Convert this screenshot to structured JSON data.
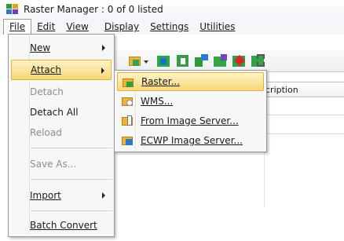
{
  "window": {
    "title": "Raster Manager : 0 of 0 listed"
  },
  "menubar": {
    "items": [
      {
        "label": "File"
      },
      {
        "label": "Edit"
      },
      {
        "label": "View"
      },
      {
        "label": "Display"
      },
      {
        "label": "Settings"
      },
      {
        "label": "Utilities"
      }
    ]
  },
  "grid": {
    "description_header": "cription"
  },
  "file_menu": {
    "items": [
      {
        "label": "New",
        "enabled": true,
        "submenu": true
      },
      {
        "label": "Attach",
        "enabled": true,
        "submenu": true,
        "highlighted": true
      },
      {
        "label": "Detach",
        "enabled": false
      },
      {
        "label": "Detach All",
        "enabled": true
      },
      {
        "label": "Reload",
        "enabled": false
      },
      {
        "label": "Save As...",
        "enabled": false
      },
      {
        "label": "Import",
        "enabled": true,
        "submenu": true
      },
      {
        "label": "Batch Convert",
        "enabled": true
      }
    ]
  },
  "attach_menu": {
    "items": [
      {
        "label": "Raster...",
        "highlighted": true
      },
      {
        "label": "WMS..."
      },
      {
        "label": "From Image Server..."
      },
      {
        "label": "ECWP Image Server..."
      }
    ]
  },
  "colors": {
    "highlight_top": "#fdf3c8",
    "highlight_bottom": "#f7d778",
    "highlight_border": "#e3b13a",
    "disabled_text": "#8d8d8d"
  }
}
